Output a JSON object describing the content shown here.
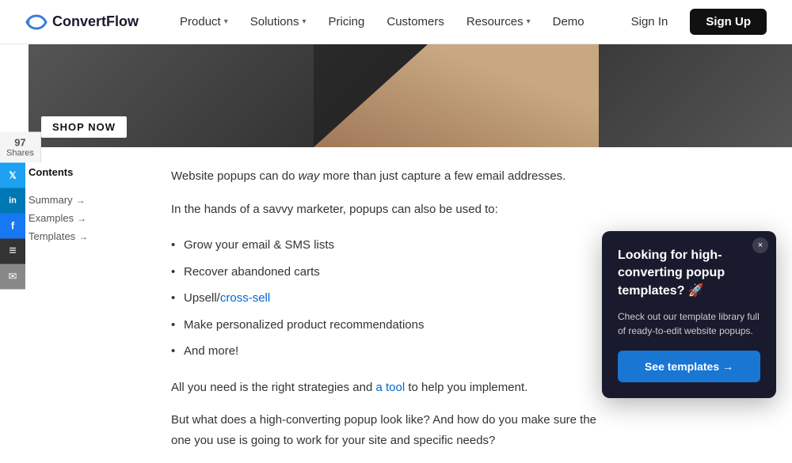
{
  "navbar": {
    "logo_text": "ConvertFlow",
    "nav_items": [
      {
        "label": "Product",
        "has_dropdown": true
      },
      {
        "label": "Solutions",
        "has_dropdown": true
      },
      {
        "label": "Pricing",
        "has_dropdown": false
      },
      {
        "label": "Customers",
        "has_dropdown": false
      },
      {
        "label": "Resources",
        "has_dropdown": true
      },
      {
        "label": "Demo",
        "has_dropdown": false
      }
    ],
    "signin_label": "Sign In",
    "signup_label": "Sign Up"
  },
  "social_sidebar": {
    "count": "97",
    "count_label": "Shares",
    "twitter_icon": "𝕏",
    "linkedin_icon": "in",
    "facebook_icon": "f",
    "buffer_icon": "≡",
    "email_icon": "✉"
  },
  "hero": {
    "shop_now": "SHOP NOW"
  },
  "toc": {
    "title": "Contents",
    "items": [
      {
        "label": "Summary",
        "arrow": "→"
      },
      {
        "label": "Examples",
        "arrow": "→"
      },
      {
        "label": "Templates",
        "arrow": "→"
      }
    ]
  },
  "article": {
    "intro_italic": "way",
    "para1_pre": "Website popups can do ",
    "para1_italic": "way",
    "para1_post": " more than just capture a few email addresses.",
    "para2": "In the hands of a savvy marketer, popups can also be used to:",
    "list_items": [
      "Grow your email & SMS lists",
      "Recover abandoned carts",
      "Upsell/cross-sell",
      "Make personalized product recommendations",
      "And more!"
    ],
    "cross_sell_link": "cross-sell",
    "para3_pre": "All you need is the right strategies and ",
    "para3_link": "a tool",
    "para3_post": " to help you implement.",
    "para4": "But what does a high-converting popup look like? And how do you make sure the one you use is going to work for your site and specific needs?"
  },
  "popup_widget": {
    "close_label": "×",
    "title": "Looking for high-converting popup templates? 🚀",
    "description": "Check out our template library full of ready-to-edit website popups.",
    "btn_label": "See templates →"
  }
}
